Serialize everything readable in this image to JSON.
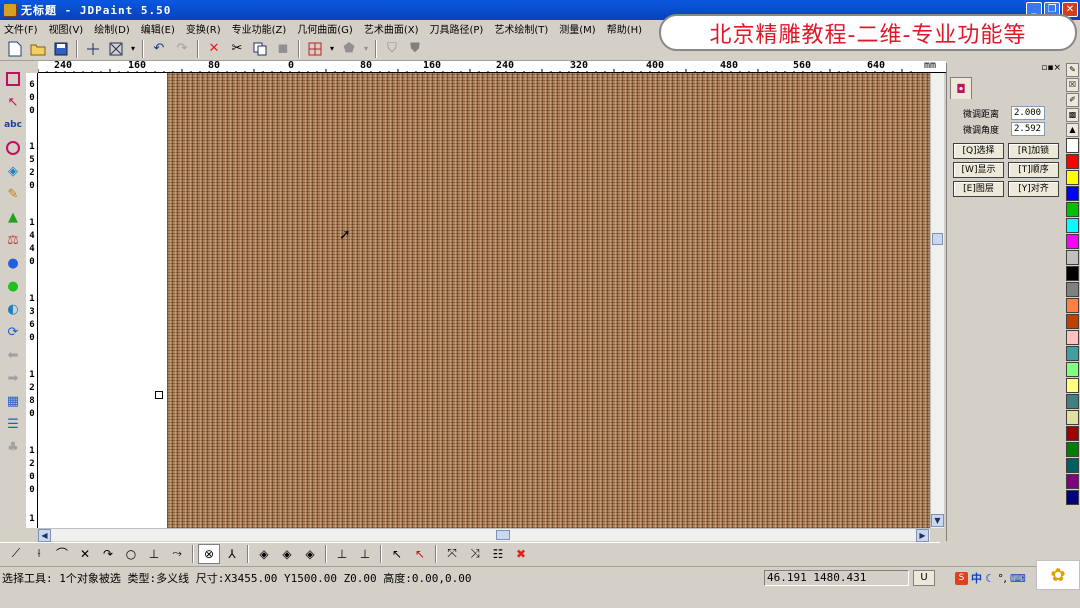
{
  "window": {
    "title": "无标题 - JDPaint 5.50"
  },
  "banner": {
    "text": "北京精雕教程-二维-专业功能等"
  },
  "menu": [
    "文件(F)",
    "视图(V)",
    "绘制(D)",
    "编辑(E)",
    "变换(R)",
    "专业功能(Z)",
    "几何曲面(G)",
    "艺术曲面(X)",
    "刀具路径(P)",
    "艺术绘制(T)",
    "测量(M)",
    "帮助(H)"
  ],
  "toolbar_icons": [
    "new-file-icon",
    "open-folder-icon",
    "save-icon",
    "crosshair-icon",
    "zoom-fit-icon",
    "undo-icon",
    "redo-icon",
    "delete-icon",
    "cut-icon",
    "copy-icon",
    "paste-icon",
    "grid-icon",
    "shape-icon",
    "shield-icon",
    "shield-dark-icon"
  ],
  "ruler": {
    "unit": "mm",
    "h_labels": [
      "240",
      "160",
      "80",
      "0",
      "80",
      "160",
      "240",
      "320",
      "400",
      "480",
      "560",
      "640"
    ],
    "v_labels": [
      "600",
      "1520",
      "1440",
      "1360",
      "1280",
      "1200",
      "1"
    ]
  },
  "panel": {
    "distance_label": "微调距离",
    "distance_value": "2.000",
    "angle_label": "微调角度",
    "angle_value": "2.592",
    "buttons": [
      "[Q]选择",
      "[R]加锁",
      "[W]显示",
      "[T]顺序",
      "[E]图层",
      "[Y]对齐"
    ]
  },
  "palette_colors": [
    "#ffffff",
    "#ff0000",
    "#ffff00",
    "#0000ff",
    "#00c000",
    "#00ffff",
    "#ff00ff",
    "#c0c0c0",
    "#000000",
    "#808080",
    "#ff8040",
    "#c04000",
    "#ffc0c0",
    "#40a0a0",
    "#80ff80",
    "#ffff80",
    "#408080",
    "#e0e0a0",
    "#a00000",
    "#008000",
    "#006060",
    "#800080",
    "#000080"
  ],
  "status": {
    "text": "选择工具: 1个对象被选 类型:多义线 尺寸:X3455.00 Y1500.00 Z0.00 高度:0.00,0.00",
    "coords": "46.191 1480.431",
    "mode": "U",
    "ime_zh": "中"
  }
}
